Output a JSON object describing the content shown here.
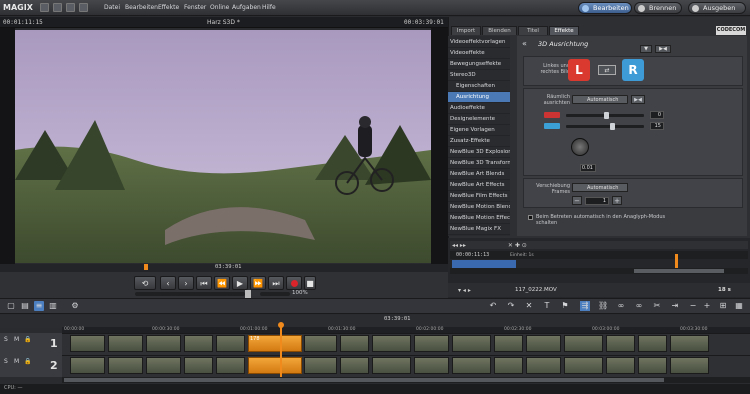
{
  "app": {
    "logo": "MAGIX",
    "title": "Harz S3D *"
  },
  "menu": [
    "Datei",
    "Bearbeiten",
    "Effekte",
    "Fenster",
    "Online",
    "Aufgaben",
    "Hilfe"
  ],
  "modes": {
    "bearbeiten": "Bearbeiten",
    "brennen": "Brennen",
    "ausgeben": "Ausgeben"
  },
  "timecodes": {
    "left": "00:01:11:15",
    "right": "00:03:39:01",
    "scrub": "03:39:01",
    "zoom": "100%",
    "timeline_top": "03:39:01"
  },
  "right_tabs": [
    "Import",
    "Blenden",
    "Titel",
    "Effekte"
  ],
  "badge": "CODECOM",
  "categories": [
    {
      "label": "Videoeffektvorlagen",
      "sub": false,
      "sel": false
    },
    {
      "label": "Videoeffekte",
      "sub": false,
      "sel": false
    },
    {
      "label": "Bewegungseffekte",
      "sub": false,
      "sel": false
    },
    {
      "label": "Stereo3D",
      "sub": false,
      "sel": false
    },
    {
      "label": "Eigenschaften",
      "sub": true,
      "sel": false
    },
    {
      "label": "Ausrichtung",
      "sub": true,
      "sel": true
    },
    {
      "label": "Audioeffekte",
      "sub": false,
      "sel": false
    },
    {
      "label": "Designelemente",
      "sub": false,
      "sel": false
    },
    {
      "label": "Eigene Vorlagen",
      "sub": false,
      "sel": false
    },
    {
      "label": "Zusatz-Effekte",
      "sub": false,
      "sel": false
    },
    {
      "label": "NewBlue 3D Explosion",
      "sub": false,
      "sel": false
    },
    {
      "label": "NewBlue 3D Transform",
      "sub": false,
      "sel": false
    },
    {
      "label": "NewBlue Art Blends",
      "sub": false,
      "sel": false
    },
    {
      "label": "NewBlue Art Effects",
      "sub": false,
      "sel": false
    },
    {
      "label": "NewBlue Film Effects",
      "sub": false,
      "sel": false
    },
    {
      "label": "NewBlue Motion Blends",
      "sub": false,
      "sel": false
    },
    {
      "label": "NewBlue Motion Effects",
      "sub": false,
      "sel": false
    },
    {
      "label": "NewBlue Magix FX",
      "sub": false,
      "sel": false
    }
  ],
  "effect": {
    "title": "3D Ausrichtung",
    "links_label": "Linkes und rechtes Bild",
    "left_badge": "L",
    "right_badge": "R",
    "raeumlich_label": "Räumlich ausrichten",
    "auto_label": "Automatisch",
    "slider1_value": "0",
    "slider2_value": "15",
    "dial_value": "0.01",
    "verschiebung_label": "Verschiebung Frames",
    "frames_value": "1",
    "checkbox_label": "Beim Betreten automatisch in den Anaglyph-Modus schalten"
  },
  "right_bottom": {
    "timecode": "00:00:11:13",
    "einheit": "Einheit: 1s",
    "filename": "117_0222.MOV",
    "rate": "18 s"
  },
  "tracks": [
    {
      "num": "1",
      "s": "S",
      "m": "M"
    },
    {
      "num": "2",
      "s": "S",
      "m": "M"
    }
  ],
  "ruler": [
    "00:00:00",
    "00:00:30:00",
    "00:01:00:00",
    "00:01:30:00",
    "00:02:00:00",
    "00:02:30:00",
    "00:03:00:00",
    "00:03:30:00"
  ],
  "clip_label": "178",
  "status": "CPU: —"
}
